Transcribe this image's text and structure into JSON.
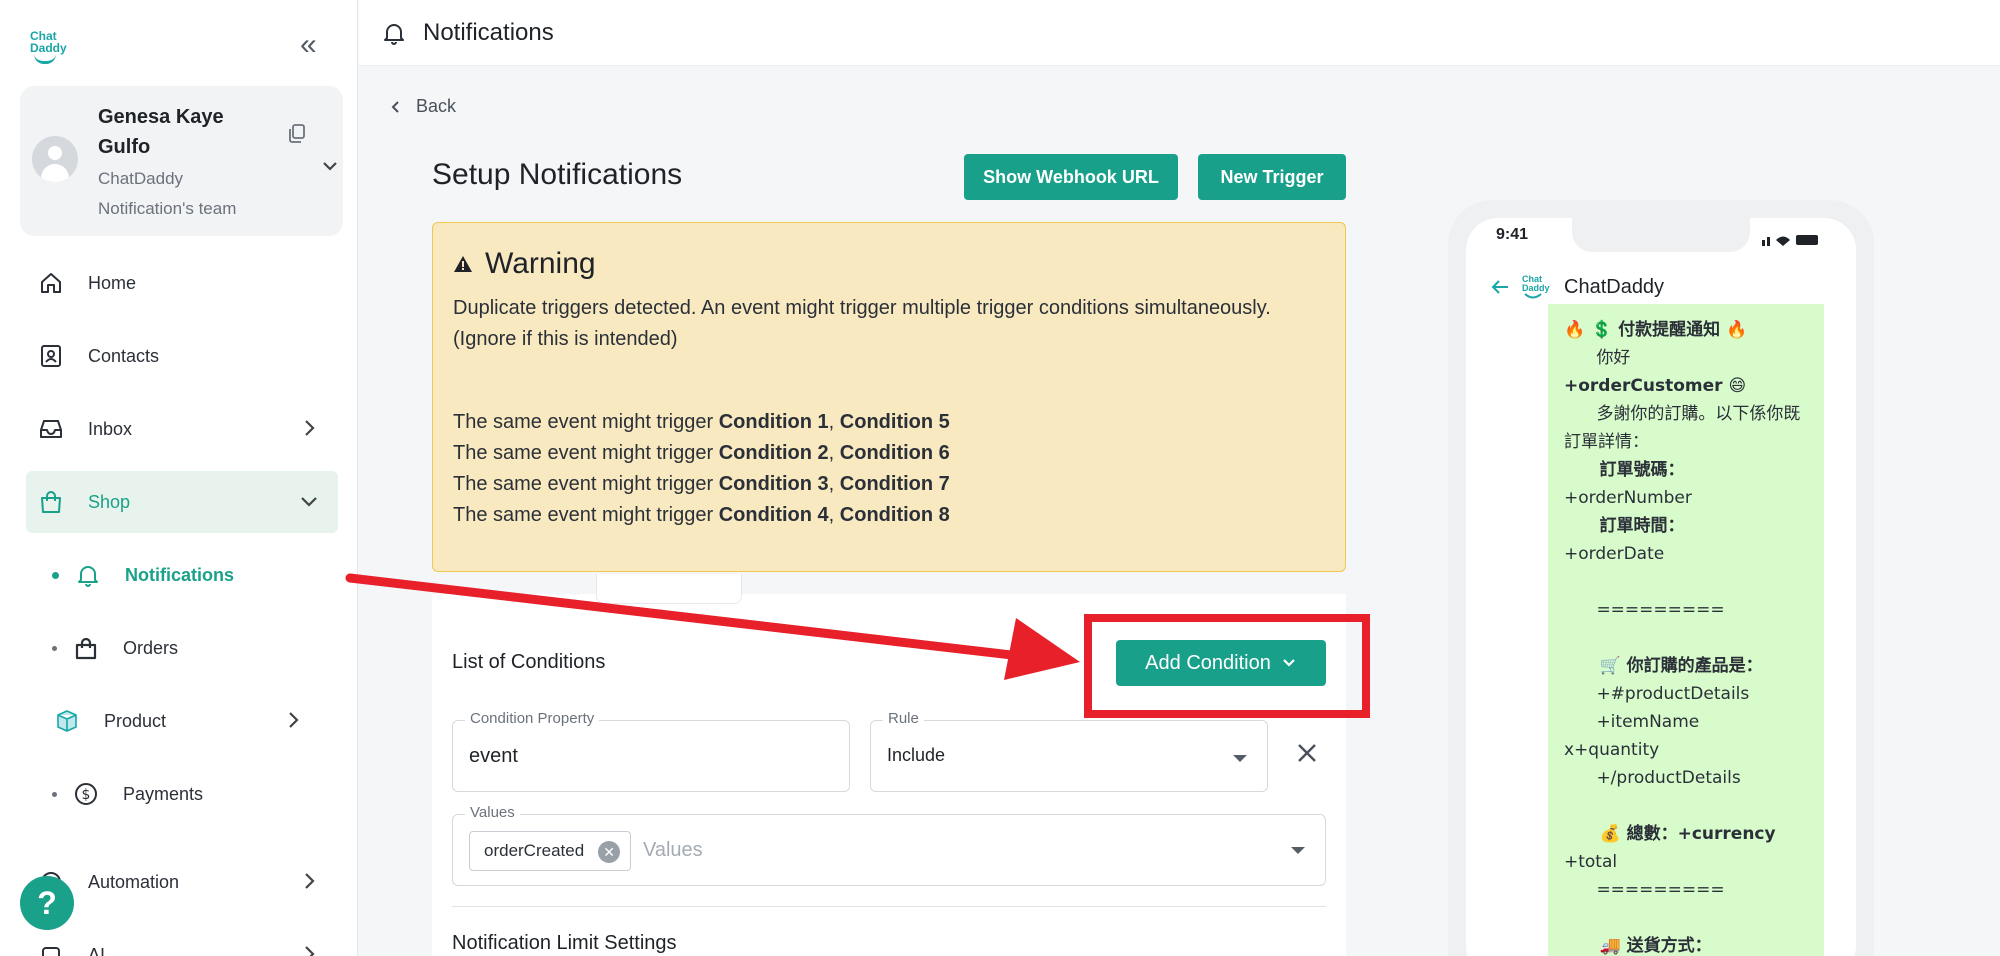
{
  "brand": {
    "logo_line1": "Chat",
    "logo_line2": "Daddy"
  },
  "profile": {
    "name": "Genesa Kaye Gulfo",
    "org": "ChatDaddy Notification's team"
  },
  "sidebar": {
    "items": [
      {
        "label": "Home"
      },
      {
        "label": "Contacts"
      },
      {
        "label": "Inbox"
      },
      {
        "label": "Shop"
      },
      {
        "label": "Notifications"
      },
      {
        "label": "Orders"
      },
      {
        "label": "Product"
      },
      {
        "label": "Payments"
      },
      {
        "label": "Automation"
      },
      {
        "label": "AI"
      }
    ],
    "help_label": "?"
  },
  "header": {
    "title": "Notifications"
  },
  "back_label": "Back",
  "setup": {
    "title": "Setup Notifications",
    "webhook_button": "Show Webhook URL",
    "new_trigger_button": "New Trigger"
  },
  "warning": {
    "title": "Warning",
    "line1": "Duplicate triggers detected. An event might trigger multiple trigger conditions simultaneously.",
    "line2": "(Ignore if this is intended)",
    "prefix": "The same event might trigger",
    "pairs": [
      {
        "a": "Condition 1",
        "b": "Condition 5"
      },
      {
        "a": "Condition 2",
        "b": "Condition 6"
      },
      {
        "a": "Condition 3",
        "b": "Condition 7"
      },
      {
        "a": "Condition 4",
        "b": "Condition 8"
      }
    ]
  },
  "conditions": {
    "title": "List of Conditions",
    "add_button": "Add Condition",
    "property_label": "Condition Property",
    "property_value": "event",
    "rule_label": "Rule",
    "rule_value": "Include",
    "values_label": "Values",
    "values_chip": "orderCreated",
    "values_placeholder": "Values",
    "limit_title": "Notification Limit Settings"
  },
  "preview": {
    "time": "9:41",
    "chat_name": "ChatDaddy",
    "lines": [
      "🔥 💲 付款提醒通知 🔥",
      "      你好",
      "+orderCustomer 😄",
      "      多謝你的訂購。以下係你既訂單詳情：",
      "      訂單號碼：",
      "+orderNumber",
      "      訂單時間：",
      "+orderDate",
      "",
      "      =========",
      "",
      "      🛒 你訂購的產品是：",
      "      +#productDetails",
      "      +itemName",
      "x+quantity",
      "      +/productDetails",
      "",
      "      💰 總數：+currency",
      "+total",
      "      =========",
      "",
      "      🚚 送貨方式："
    ]
  },
  "colors": {
    "accent": "#18a08a",
    "warning_bg": "#f8e9c0",
    "warning_border": "#f0c94e",
    "highlight_red": "#e8202a",
    "bubble": "#d8fbcc"
  }
}
